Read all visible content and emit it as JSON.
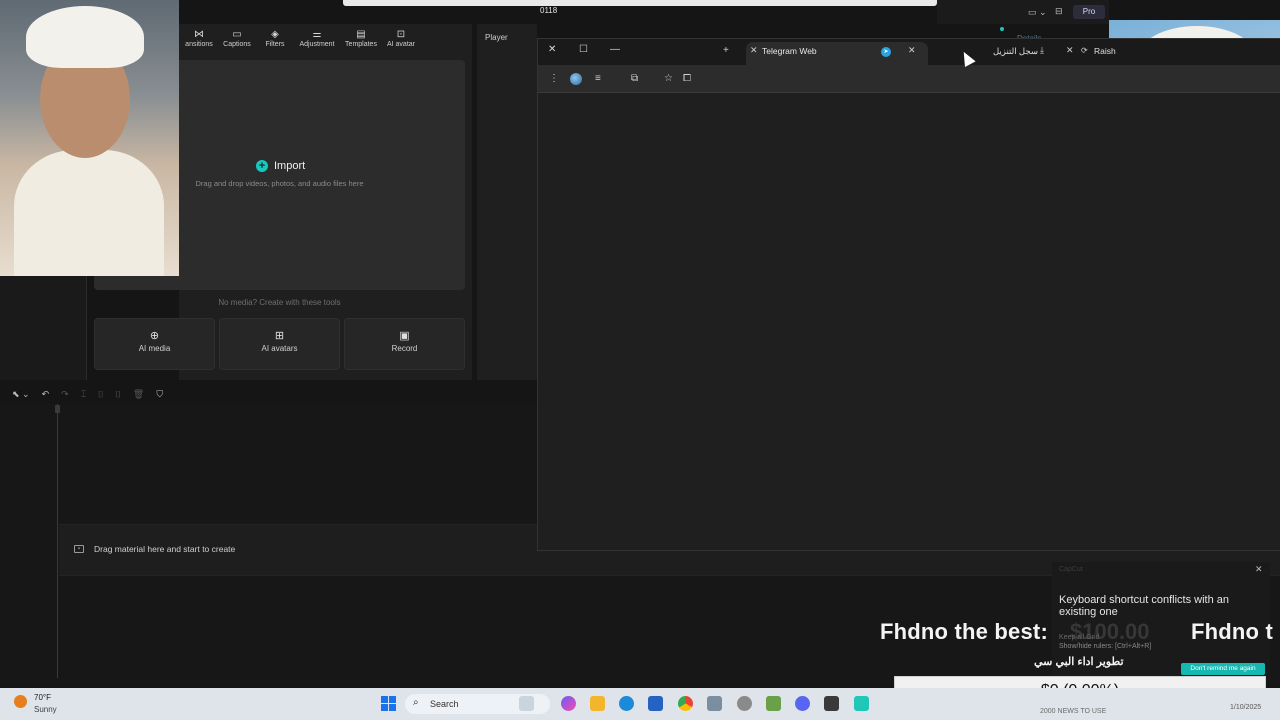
{
  "top": {
    "counter": "0118",
    "pro_label": "Pro",
    "details_label": "Details"
  },
  "toolbar": {
    "tools": [
      {
        "label": "ansitions",
        "icon": "⋈"
      },
      {
        "label": "Captions",
        "icon": "▭"
      },
      {
        "label": "Filters",
        "icon": "◈"
      },
      {
        "label": "Adjustment",
        "icon": "⚌"
      },
      {
        "label": "Templates",
        "icon": "▤"
      },
      {
        "label": "AI avatar",
        "icon": "⊡"
      }
    ]
  },
  "media": {
    "import_label": "Import",
    "import_hint": "Drag and drop videos, photos, and audio files here",
    "no_media": "No media? Create with these tools",
    "cards": [
      {
        "label": "AI media",
        "icon": "⊕"
      },
      {
        "label": "AI avatars",
        "icon": "⊞"
      },
      {
        "label": "Record",
        "icon": "▣"
      }
    ]
  },
  "player": {
    "label": "Player"
  },
  "timeline": {
    "drag_hint": "Drag material here and start to create"
  },
  "browser": {
    "active_tab": "Telegram Web",
    "tab3_title": "سجل التنزيل",
    "tab4_title": "Raish"
  },
  "toast": {
    "brand": "CapCut",
    "title": "Keyboard shortcut conflicts with an existing one",
    "line1": "Keep all Grid",
    "line2": "Show/hide rulers: [Ctrl+Alt+R]",
    "button": "Don't remind me again"
  },
  "overlay": {
    "text_left": "Fhdno the best:",
    "amount_faded": "$100.00",
    "text_right": "Fhdno t",
    "arabic": "تطوير اداء البي سي",
    "price": "$0 (0.00%)"
  },
  "taskbar": {
    "temp": "70°F",
    "condition": "Sunny",
    "search_label": "Search",
    "tray_text": "2000 NEWS TO USE",
    "date": "1/10/2025"
  },
  "colors": {
    "accent": "#18c8c0",
    "telegram": "#2aa3e0",
    "taskbar": "#dfe4ea"
  }
}
